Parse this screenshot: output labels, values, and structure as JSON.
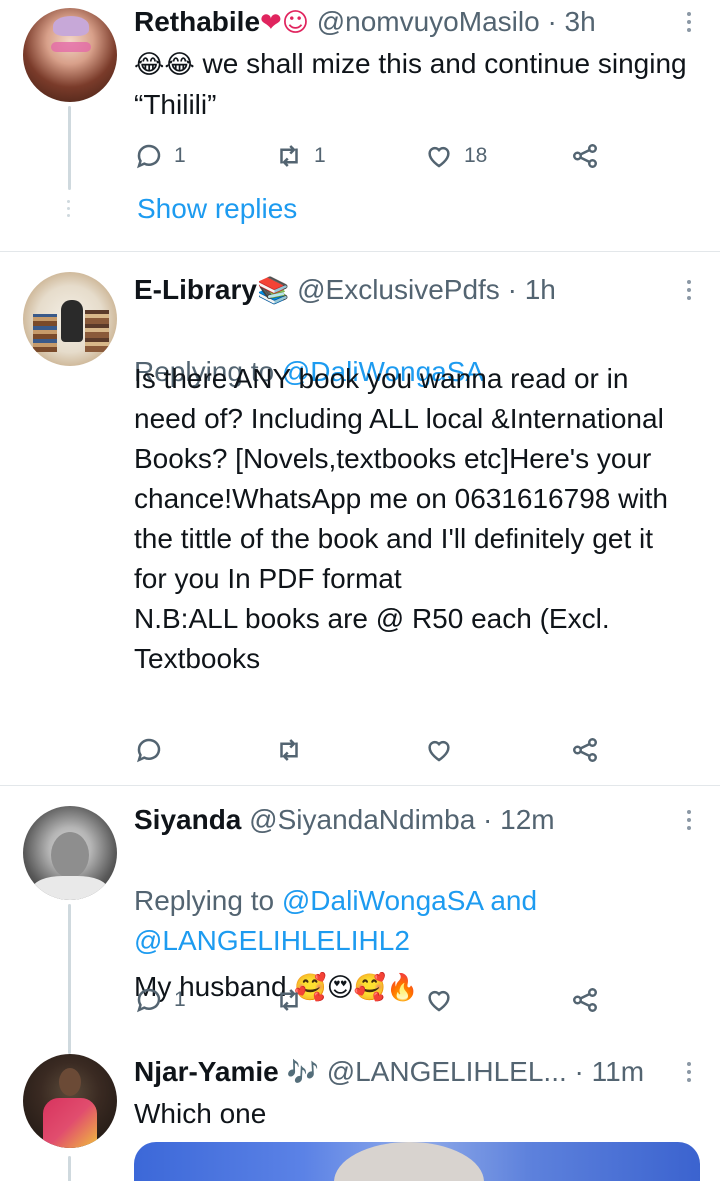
{
  "tweets": [
    {
      "name": "Rethabile",
      "name_emoji": "❤☺",
      "handle": "@nomvuyoMasilo",
      "time": "· 3h",
      "emoji_prefix": "😂😂",
      "text": " we shall mize this and continue singing “Thilili”",
      "replies": "1",
      "retweets": "1",
      "likes": "18",
      "show_replies": "Show replies"
    },
    {
      "name": "E-Library",
      "name_emoji": "📚",
      "handle": "@ExclusivePdfs",
      "time": "· 1h",
      "replying_prefix": "Replying to ",
      "replying_to": "@DaliWongaSA",
      "text": "Is there ANY book you wanna read or in need of? Including ALL local &International Books? [Novels,textbooks etc]Here's your chance!WhatsApp me on 0631616798 with the tittle of the book and I'll definitely get it for you In PDF format\nN.B:ALL books are @ R50 each (Excl. Textbooks",
      "replies": "",
      "retweets": "",
      "likes": ""
    },
    {
      "name": "Siyanda",
      "handle": "@SiyandaNdimba",
      "time": "· 12m",
      "replying_prefix": "Replying to ",
      "replying_to": "@DaliWongaSA and",
      "replying_to_2": "@LANGELIHLELIHL2",
      "text": "My husband ",
      "text_emoji": "🥰😍🥰🔥",
      "replies": "1",
      "retweets": "",
      "likes": ""
    },
    {
      "name": "Njar-Yamie",
      "name_emoji": "🎶",
      "handle": "@LANGELIHLEL...",
      "time": "· 11m",
      "text": "Which one"
    }
  ],
  "icons": {
    "reply": "reply-icon",
    "retweet": "retweet-icon",
    "like": "heart-icon",
    "share": "share-icon",
    "more": "more-vertical-icon"
  },
  "colors": {
    "link": "#1d9bf0",
    "secondary": "#536471",
    "primary": "#0f1419",
    "heart": "#e0245e"
  }
}
